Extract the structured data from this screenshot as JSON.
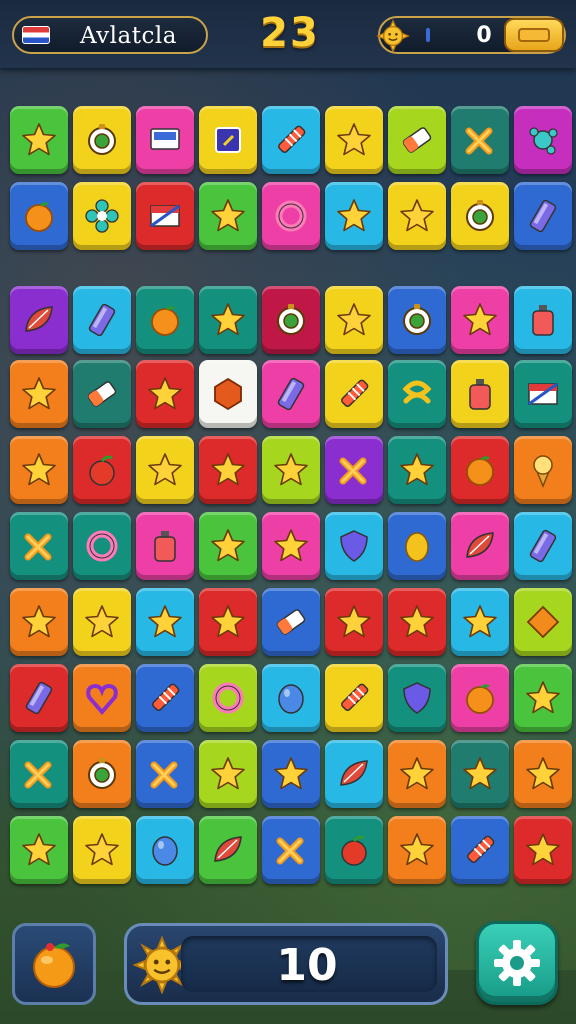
{
  "header": {
    "player_name": "Avlatcla",
    "level": "23",
    "coins": "0"
  },
  "footer": {
    "moves": "10"
  },
  "colors": {
    "green": "#49c43c",
    "yellow": "#f3d21c",
    "pink": "#ee3fa6",
    "cyan": "#28b8e6",
    "teal": "#14907e",
    "blue": "#2f6ad2",
    "red": "#dd2a2a",
    "orange": "#f27e1c",
    "purple": "#8a2ed0",
    "lime": "#a6d61e",
    "magenta": "#c62ebe",
    "darkteal": "#1f7c6e",
    "white": "#f6f6f2",
    "crimson": "#c01846"
  },
  "board": {
    "rows": [
      [
        [
          "green",
          "star-icon"
        ],
        [
          "yellow",
          "compass-icon"
        ],
        [
          "pink",
          "screen-icon"
        ],
        [
          "yellow",
          "square-icon"
        ],
        [
          "cyan",
          "crayon-icon"
        ],
        [
          "yellow",
          "star-icon"
        ],
        [
          "lime",
          "eraser-icon"
        ],
        [
          "darkteal",
          "cross-icon"
        ],
        [
          "magenta",
          "splat-icon"
        ]
      ],
      [
        [
          "blue",
          "orange-icon"
        ],
        [
          "yellow",
          "flower-icon"
        ],
        [
          "red",
          "flag-icon"
        ],
        [
          "green",
          "star-icon"
        ],
        [
          "pink",
          "ring-icon"
        ],
        [
          "cyan",
          "star-icon"
        ],
        [
          "yellow",
          "star-icon"
        ],
        [
          "yellow",
          "compass-icon"
        ],
        [
          "blue",
          "gem-icon"
        ]
      ],
      [
        [
          "purple",
          "leaf-icon"
        ],
        [
          "cyan",
          "gem-icon"
        ],
        [
          "teal",
          "orange-icon"
        ],
        [
          "teal",
          "star-icon"
        ],
        [
          "crimson",
          "compass-icon"
        ],
        [
          "yellow",
          "star-icon"
        ],
        [
          "blue",
          "compass-icon"
        ],
        [
          "pink",
          "star-icon"
        ],
        [
          "cyan",
          "bottle-icon"
        ]
      ],
      [
        [
          "orange",
          "star-icon"
        ],
        [
          "darkteal",
          "eraser-icon"
        ],
        [
          "red",
          "star-icon"
        ],
        [
          "white",
          "hexagon-icon"
        ],
        [
          "pink",
          "gem-icon"
        ],
        [
          "yellow",
          "crayon-icon"
        ],
        [
          "teal",
          "knot-icon"
        ],
        [
          "yellow",
          "bottle-icon"
        ],
        [
          "teal",
          "flag-icon"
        ]
      ],
      [
        [
          "orange",
          "star-icon"
        ],
        [
          "red",
          "apple-icon"
        ],
        [
          "yellow",
          "star-icon"
        ],
        [
          "red",
          "star-icon"
        ],
        [
          "lime",
          "star-icon"
        ],
        [
          "purple",
          "cross-icon"
        ],
        [
          "teal",
          "star-icon"
        ],
        [
          "red",
          "orange-icon"
        ],
        [
          "orange",
          "icecream-icon"
        ]
      ],
      [
        [
          "teal",
          "cross-icon"
        ],
        [
          "teal",
          "ring-icon"
        ],
        [
          "pink",
          "bottle-icon"
        ],
        [
          "green",
          "star-icon"
        ],
        [
          "pink",
          "star-icon"
        ],
        [
          "cyan",
          "shield-icon"
        ],
        [
          "blue",
          "lemon-icon"
        ],
        [
          "pink",
          "leaf-icon"
        ],
        [
          "cyan",
          "gem-icon"
        ]
      ],
      [
        [
          "orange",
          "star-icon"
        ],
        [
          "yellow",
          "star-icon"
        ],
        [
          "cyan",
          "star-icon"
        ],
        [
          "red",
          "star-icon"
        ],
        [
          "blue",
          "eraser-icon"
        ],
        [
          "red",
          "star-icon"
        ],
        [
          "red",
          "star-icon"
        ],
        [
          "cyan",
          "star-icon"
        ],
        [
          "lime",
          "diamond-icon"
        ]
      ],
      [
        [
          "red",
          "gem-icon"
        ],
        [
          "orange",
          "heart-icon"
        ],
        [
          "blue",
          "crayon-icon"
        ],
        [
          "lime",
          "ring-icon"
        ],
        [
          "cyan",
          "egg-icon"
        ],
        [
          "yellow",
          "crayon-icon"
        ],
        [
          "teal",
          "shield-icon"
        ],
        [
          "pink",
          "orange-icon"
        ],
        [
          "green",
          "star-icon"
        ]
      ],
      [
        [
          "teal",
          "cross-icon"
        ],
        [
          "orange",
          "compass-icon"
        ],
        [
          "blue",
          "cross-icon"
        ],
        [
          "lime",
          "star-icon"
        ],
        [
          "blue",
          "star-icon"
        ],
        [
          "cyan",
          "leaf-icon"
        ],
        [
          "orange",
          "star-icon"
        ],
        [
          "darkteal",
          "star-icon"
        ],
        [
          "orange",
          "star-icon"
        ]
      ],
      [
        [
          "green",
          "star-icon"
        ],
        [
          "yellow",
          "star-icon"
        ],
        [
          "cyan",
          "egg-icon"
        ],
        [
          "green",
          "leaf-icon"
        ],
        [
          "blue",
          "cross-icon"
        ],
        [
          "teal",
          "apple-icon"
        ],
        [
          "orange",
          "star-icon"
        ],
        [
          "blue",
          "crayon-icon"
        ],
        [
          "red",
          "star-icon"
        ]
      ]
    ]
  }
}
